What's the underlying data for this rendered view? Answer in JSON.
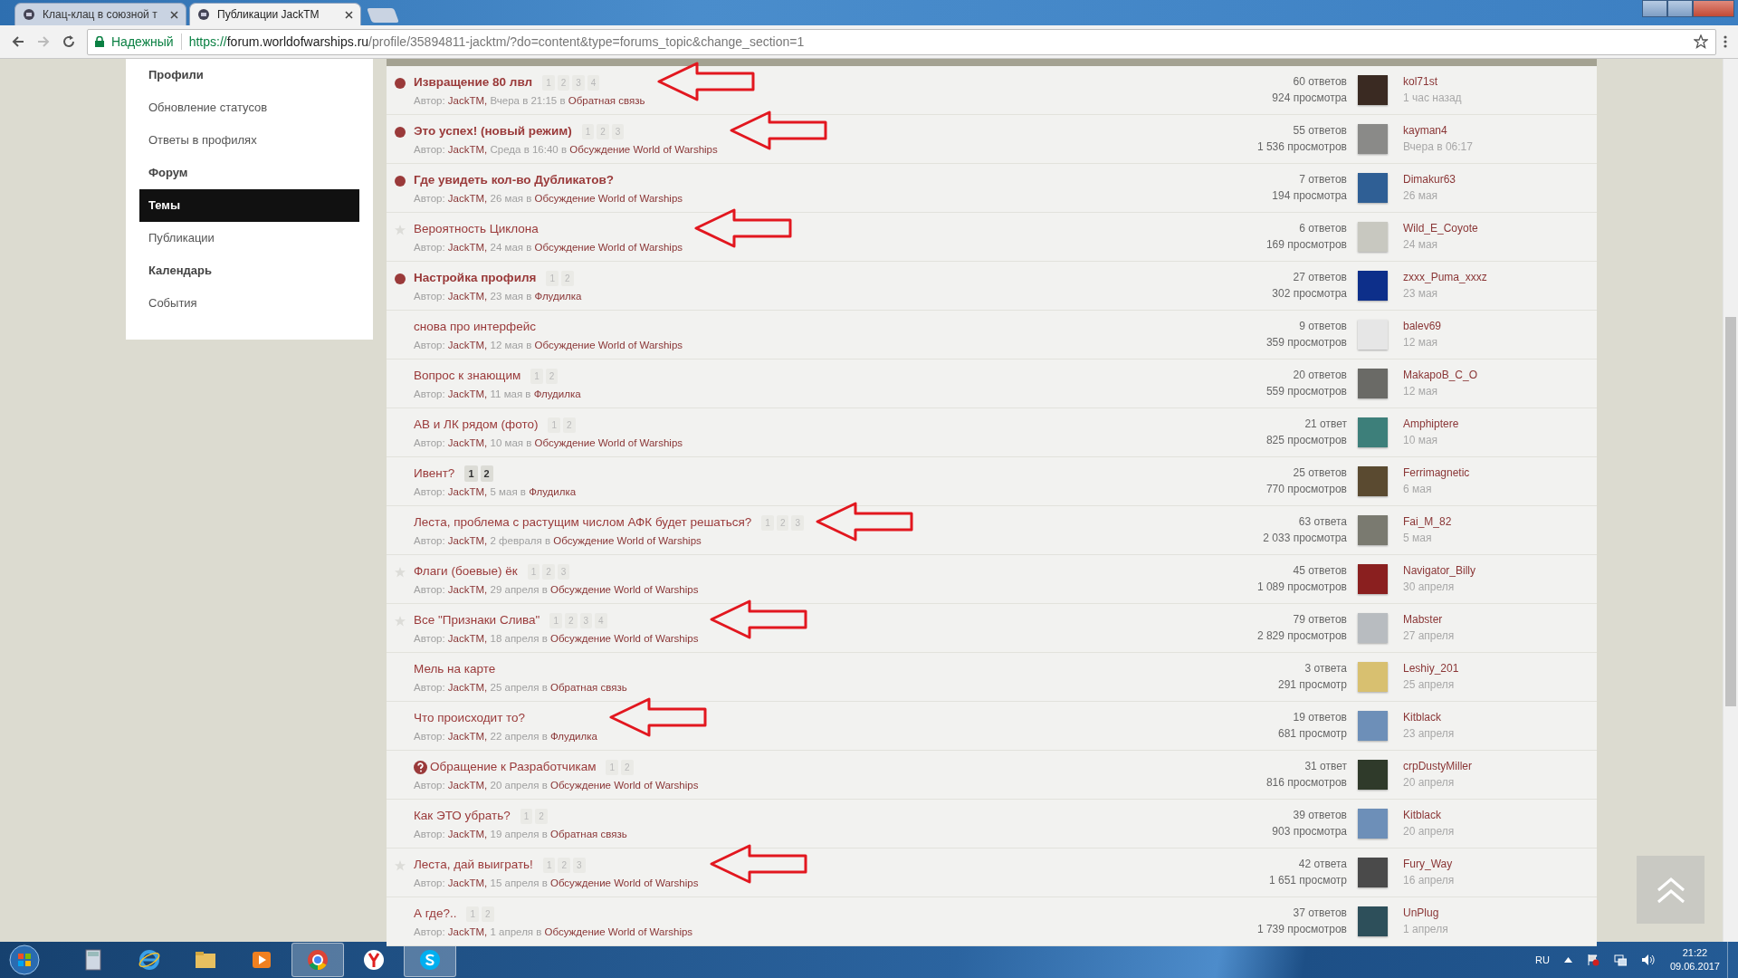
{
  "browser": {
    "tabs": [
      {
        "title": "Клац-клац в союзной т",
        "selected": false
      },
      {
        "title": "Публикации JackTM",
        "selected": true
      }
    ],
    "security_label": "Надежный",
    "url": {
      "scheme": "https://",
      "host": "forum.worldofwarships.ru",
      "path": "/profile/35894811-jacktm/?do=content&type=forums_topic&change_section=1"
    }
  },
  "sidebar": {
    "items": [
      {
        "kind": "heading",
        "label": "Профили",
        "selected": false
      },
      {
        "kind": "link",
        "label": "Обновление статусов",
        "selected": false
      },
      {
        "kind": "link",
        "label": "Ответы в профилях",
        "selected": false
      },
      {
        "kind": "heading",
        "label": "Форум",
        "selected": false
      },
      {
        "kind": "link",
        "label": "Темы",
        "selected": true
      },
      {
        "kind": "link",
        "label": "Публикации",
        "selected": false
      },
      {
        "kind": "heading",
        "label": "Календарь",
        "selected": false
      },
      {
        "kind": "link",
        "label": "События",
        "selected": false
      }
    ]
  },
  "topics": [
    {
      "unread": true,
      "starred": false,
      "title": "Извращение 80 лвл",
      "pages": [
        "1",
        "2",
        "3",
        "4"
      ],
      "pages_emphasized": false,
      "annotated": true,
      "meta": {
        "by": "Автор:",
        "author": "JackTM,",
        "when": "Вчера в 21:15 в",
        "forum": "Обратная связь"
      },
      "replies": "60 ответов",
      "views": "924 просмотра",
      "last_poster": "kol71st",
      "last_time": "1 час назад"
    },
    {
      "unread": true,
      "starred": false,
      "title": "Это успех! (новый режим)",
      "pages": [
        "1",
        "2",
        "3"
      ],
      "pages_emphasized": false,
      "annotated": true,
      "meta": {
        "by": "Автор:",
        "author": "JackTM,",
        "when": "Среда в 16:40 в",
        "forum": "Обсуждение World of Warships"
      },
      "replies": "55 ответов",
      "views": "1 536 просмотров",
      "last_poster": "kayman4",
      "last_time": "Вчера в 06:17"
    },
    {
      "unread": true,
      "starred": false,
      "title": "Где увидеть кол-во Дубликатов?",
      "annotated": false,
      "meta": {
        "by": "Автор:",
        "author": "JackTM,",
        "when": "26 мая в",
        "forum": "Обсуждение World of Warships"
      },
      "replies": "7 ответов",
      "views": "194 просмотра",
      "last_poster": "Dimakur63",
      "last_time": "26 мая"
    },
    {
      "unread": false,
      "starred": true,
      "title": "Вероятность Циклона",
      "annotated": true,
      "meta": {
        "by": "Автор:",
        "author": "JackTM,",
        "when": "24 мая в",
        "forum": "Обсуждение World of Warships"
      },
      "replies": "6 ответов",
      "views": "169 просмотров",
      "last_poster": "Wild_E_Coyote",
      "last_time": "24 мая"
    },
    {
      "unread": true,
      "starred": false,
      "title": "Настройка профиля",
      "pages": [
        "1",
        "2"
      ],
      "pages_emphasized": false,
      "annotated": false,
      "meta": {
        "by": "Автор:",
        "author": "JackTM,",
        "when": "23 мая в",
        "forum": "Флудилка"
      },
      "replies": "27 ответов",
      "views": "302 просмотра",
      "last_poster": "zxxx_Puma_xxxz",
      "last_time": "23 мая"
    },
    {
      "unread": false,
      "starred": false,
      "title": "снова про интерфейс",
      "annotated": false,
      "meta": {
        "by": "Автор:",
        "author": "JackTM,",
        "when": "12 мая в",
        "forum": "Обсуждение World of Warships"
      },
      "replies": "9 ответов",
      "views": "359 просмотров",
      "last_poster": "balev69",
      "last_time": "12 мая"
    },
    {
      "unread": false,
      "starred": false,
      "title": "Вопрос к знающим",
      "pages": [
        "1",
        "2"
      ],
      "pages_emphasized": false,
      "annotated": false,
      "meta": {
        "by": "Автор:",
        "author": "JackTM,",
        "when": "11 мая в",
        "forum": "Флудилка"
      },
      "replies": "20 ответов",
      "views": "559 просмотров",
      "last_poster": "MakapoB_C_O",
      "last_time": "12 мая"
    },
    {
      "unread": false,
      "starred": false,
      "title": "АВ и ЛК рядом (фото)",
      "pages": [
        "1",
        "2"
      ],
      "pages_emphasized": false,
      "annotated": false,
      "meta": {
        "by": "Автор:",
        "author": "JackTM,",
        "when": "10 мая в",
        "forum": "Обсуждение World of Warships"
      },
      "replies": "21 ответ",
      "views": "825 просмотров",
      "last_poster": "Amphiptere",
      "last_time": "10 мая"
    },
    {
      "unread": false,
      "starred": false,
      "title": "Ивент?",
      "pages": [
        "1",
        "2"
      ],
      "pages_emphasized": true,
      "annotated": false,
      "meta": {
        "by": "Автор:",
        "author": "JackTM,",
        "when": "5 мая в",
        "forum": "Флудилка"
      },
      "replies": "25 ответов",
      "views": "770 просмотров",
      "last_poster": "Ferrimagnetic",
      "last_time": "6 мая"
    },
    {
      "unread": false,
      "starred": false,
      "title": "Леста, проблема с растущим числом АФК будет решаться?",
      "pages": [
        "1",
        "2",
        "3"
      ],
      "pages_emphasized": false,
      "annotated": true,
      "meta": {
        "by": "Автор:",
        "author": "JackTM,",
        "when": "2 февраля в",
        "forum": "Обсуждение World of Warships"
      },
      "replies": "63 ответа",
      "views": "2 033 просмотра",
      "last_poster": "Fai_M_82",
      "last_time": "5 мая"
    },
    {
      "unread": false,
      "starred": true,
      "title": "Флаги (боевые) ёк",
      "pages": [
        "1",
        "2",
        "3"
      ],
      "pages_emphasized": false,
      "annotated": false,
      "meta": {
        "by": "Автор:",
        "author": "JackTM,",
        "when": "29 апреля в",
        "forum": "Обсуждение World of Warships"
      },
      "replies": "45 ответов",
      "views": "1 089 просмотров",
      "last_poster": "Navigator_Billy",
      "last_time": "30 апреля"
    },
    {
      "unread": false,
      "starred": true,
      "title": "Все \"Признаки Слива\"",
      "pages": [
        "1",
        "2",
        "3",
        "4"
      ],
      "pages_emphasized": false,
      "annotated": true,
      "meta": {
        "by": "Автор:",
        "author": "JackTM,",
        "when": "18 апреля в",
        "forum": "Обсуждение World of Warships"
      },
      "replies": "79 ответов",
      "views": "2 829 просмотров",
      "last_poster": "Mabster",
      "last_time": "27 апреля"
    },
    {
      "unread": false,
      "starred": false,
      "title": "Мель на карте",
      "annotated": false,
      "meta": {
        "by": "Автор:",
        "author": "JackTM,",
        "when": "25 апреля в",
        "forum": "Обратная связь"
      },
      "replies": "3 ответа",
      "views": "291 просмотр",
      "last_poster": "Leshiy_201",
      "last_time": "25 апреля"
    },
    {
      "unread": false,
      "starred": false,
      "title": "Что происходит то?",
      "annotated": true,
      "meta": {
        "by": "Автор:",
        "author": "JackTM,",
        "when": "22 апреля в",
        "forum": "Флудилка"
      },
      "replies": "19 ответов",
      "views": "681 просмотр",
      "last_poster": "Kitblack",
      "last_time": "23 апреля"
    },
    {
      "unread": false,
      "starred": false,
      "question": true,
      "title": "Обращение к Разработчикам",
      "pages": [
        "1",
        "2"
      ],
      "pages_emphasized": false,
      "annotated": false,
      "meta": {
        "by": "Автор:",
        "author": "JackTM,",
        "when": "20 апреля в",
        "forum": "Обсуждение World of Warships"
      },
      "replies": "31 ответ",
      "views": "816 просмотров",
      "last_poster": "crpDustyMiller",
      "last_time": "20 апреля"
    },
    {
      "unread": false,
      "starred": false,
      "title": "Как ЭТО убрать?",
      "pages": [
        "1",
        "2"
      ],
      "pages_emphasized": false,
      "annotated": false,
      "meta": {
        "by": "Автор:",
        "author": "JackTM,",
        "when": "19 апреля в",
        "forum": "Обратная связь"
      },
      "replies": "39 ответов",
      "views": "903 просмотра",
      "last_poster": "Kitblack",
      "last_time": "20 апреля"
    },
    {
      "unread": false,
      "starred": true,
      "title": "Леста, дай выиграть!",
      "pages": [
        "1",
        "2",
        "3"
      ],
      "pages_emphasized": false,
      "annotated": true,
      "meta": {
        "by": "Автор:",
        "author": "JackTM,",
        "when": "15 апреля в",
        "forum": "Обсуждение World of Warships"
      },
      "replies": "42 ответа",
      "views": "1 651 просмотр",
      "last_poster": "Fury_Way",
      "last_time": "16 апреля"
    },
    {
      "unread": false,
      "starred": false,
      "title": "А где?..",
      "pages": [
        "1",
        "2"
      ],
      "pages_emphasized": false,
      "annotated": false,
      "meta": {
        "by": "Автор:",
        "author": "JackTM,",
        "when": "1 апреля в",
        "forum": "Обсуждение World of Warships"
      },
      "replies": "37 ответов",
      "views": "1 739 просмотров",
      "last_poster": "UnPlug",
      "last_time": "1 апреля"
    }
  ],
  "taskbar": {
    "apps": [
      {
        "kind": "calculator",
        "active": false
      },
      {
        "kind": "browser-e",
        "active": false
      },
      {
        "kind": "folder",
        "active": false
      },
      {
        "kind": "player",
        "active": false
      },
      {
        "kind": "chrome",
        "active": true
      },
      {
        "kind": "yandex",
        "active": false
      },
      {
        "kind": "skype",
        "active": true
      }
    ],
    "language": "RU",
    "time": "21:22",
    "date": "09.06.2017"
  }
}
